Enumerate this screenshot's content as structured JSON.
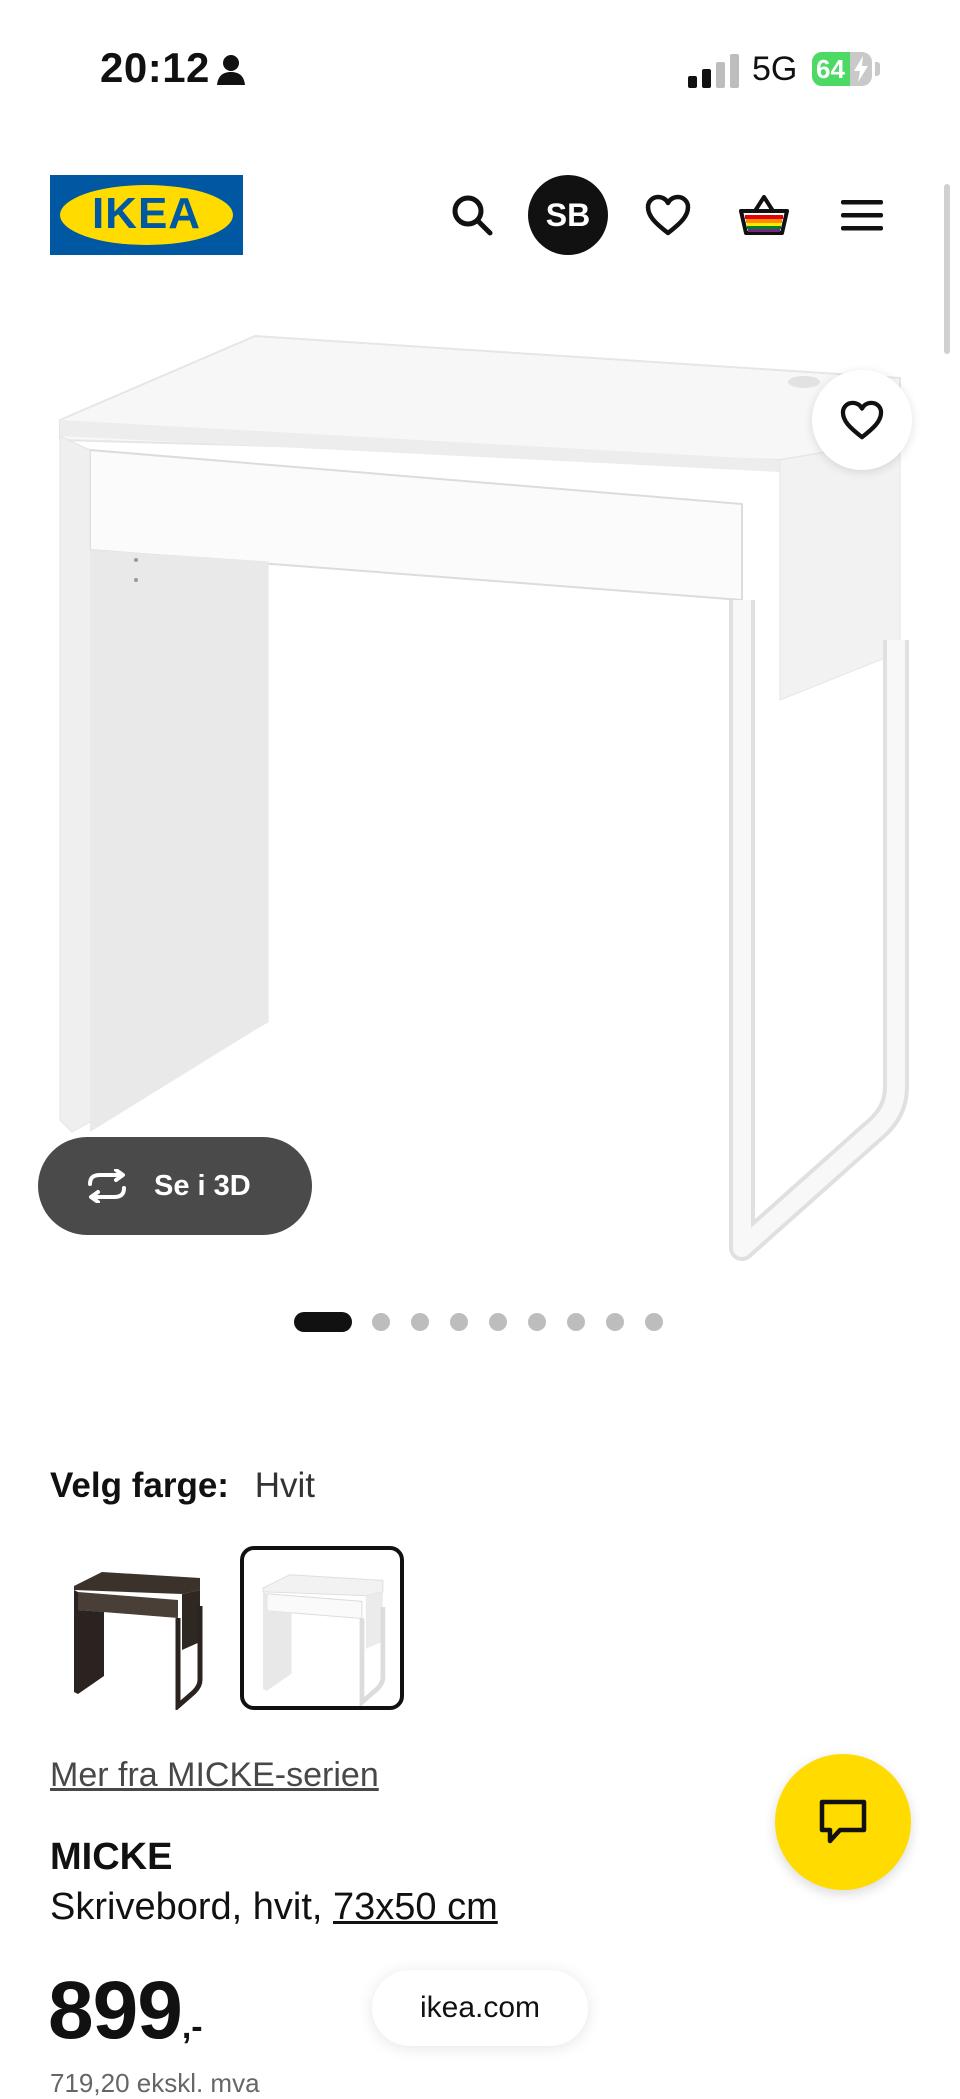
{
  "status_bar": {
    "time": "20:12",
    "network": "5G",
    "battery": "64",
    "battery_level": 0.64,
    "battery_color": "#4cd964"
  },
  "header": {
    "logo_text": "IKEA",
    "avatar_initials": "SB",
    "icons": [
      "search-icon",
      "heart-icon",
      "cart-icon",
      "hamburger-menu-icon"
    ],
    "brand_blue": "#0058a3",
    "brand_yellow": "#ffdb00"
  },
  "gallery": {
    "view_3d_label": "Se i 3D",
    "image_count": 9,
    "active_index": 0
  },
  "color_picker": {
    "label": "Velg farge:",
    "value": "Hvit",
    "options": [
      "dark",
      "white"
    ],
    "selected": "white"
  },
  "product": {
    "series_link": "Mer fra MICKE-serien",
    "name": "MICKE",
    "description": "Skrivebord, hvit, ",
    "dimensions": "73x50 cm",
    "price": "899",
    "price_suffix": ",-",
    "price_subtext": "719,20 ekskl. mva"
  },
  "browser": {
    "url": "ikea.com"
  }
}
